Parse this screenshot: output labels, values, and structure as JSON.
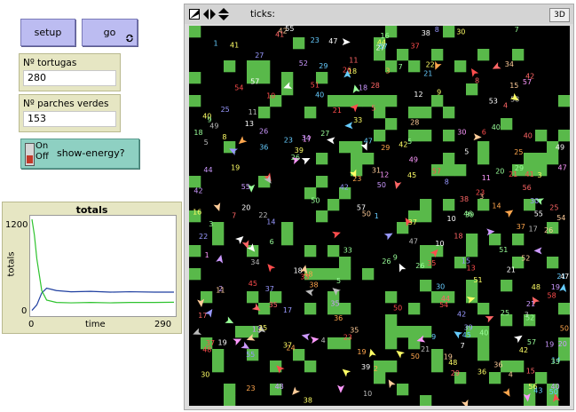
{
  "interface": {
    "setup_label": "setup",
    "go_label": "go",
    "turtles_monitor": {
      "label": "Nº tortugas",
      "value": "280"
    },
    "green_monitor": {
      "label": "Nº parches verdes",
      "value": "153"
    },
    "switch": {
      "on": "On",
      "off": "Off",
      "label": "show-energy?"
    },
    "plot": {
      "title": "totals",
      "ylabel": "totals",
      "xlabel": "time",
      "ymax": "1200",
      "ymin": "0",
      "xmin": "0",
      "xmax": "290"
    },
    "view": {
      "ticks_label": "ticks:",
      "threed_label": "3D"
    }
  },
  "colors": {
    "button": "#bcbcf1",
    "monitor": "#e6e6c3",
    "switch": "#8ed0c2",
    "grass": "#59b94a",
    "world_bg": "#000000",
    "turtles_line": "#1f3fa0",
    "grass_line": "#2ec32e"
  },
  "chart_data": {
    "type": "line",
    "title": "totals",
    "xlabel": "time",
    "ylabel": "totals",
    "xlim": [
      0,
      290
    ],
    "ylim": [
      0,
      1200
    ],
    "series": [
      {
        "x": [
          0,
          10,
          20,
          30,
          50,
          80,
          120,
          160,
          200,
          250,
          290
        ],
        "values": [
          50,
          120,
          270,
          330,
          300,
          285,
          290,
          280,
          285,
          280,
          280
        ]
      },
      {
        "x": [
          0,
          5,
          10,
          20,
          30,
          50,
          80,
          120,
          160,
          200,
          250,
          290
        ],
        "values": [
          1200,
          1000,
          700,
          300,
          180,
          150,
          145,
          150,
          145,
          150,
          150,
          153
        ]
      }
    ]
  }
}
